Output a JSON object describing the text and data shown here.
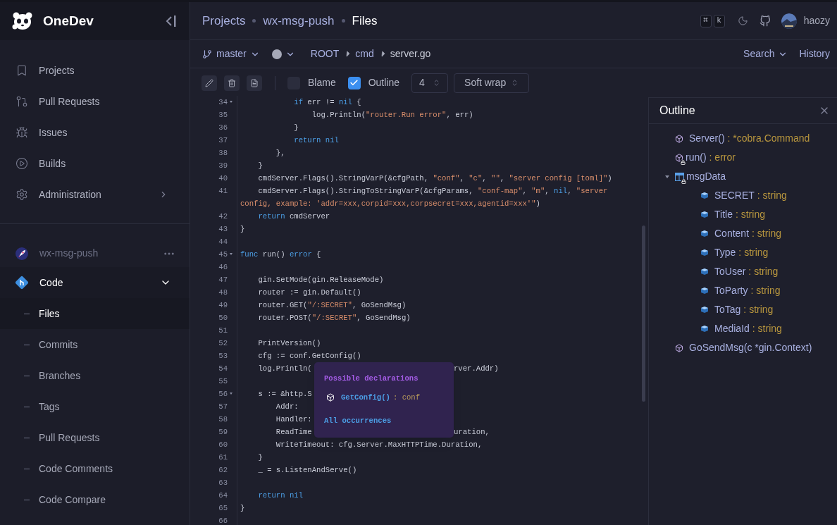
{
  "sidebar": {
    "brand": "OneDev",
    "nav": [
      {
        "kind": "projects",
        "label": "Projects",
        "has_children": false
      },
      {
        "kind": "pull-requests",
        "label": "Pull Requests",
        "has_children": false
      },
      {
        "kind": "issues",
        "label": "Issues",
        "has_children": false
      },
      {
        "kind": "builds",
        "label": "Builds",
        "has_children": false
      },
      {
        "kind": "administration",
        "label": "Administration",
        "has_children": true
      }
    ],
    "project": {
      "name": "wx-msg-push"
    },
    "project_nav": {
      "label": "Code",
      "expanded": true,
      "children": [
        {
          "label": "Files",
          "selected": true
        },
        {
          "label": "Commits",
          "selected": false
        },
        {
          "label": "Branches",
          "selected": false
        },
        {
          "label": "Tags",
          "selected": false
        },
        {
          "label": "Pull Requests",
          "selected": false
        },
        {
          "label": "Code Comments",
          "selected": false
        },
        {
          "label": "Code Compare",
          "selected": false
        }
      ]
    }
  },
  "header": {
    "breadcrumbs": [
      "Projects",
      "wx-msg-push",
      "Files"
    ],
    "shortcut": [
      "⌘",
      "k"
    ],
    "user": "haozy"
  },
  "file_bar": {
    "branch": "master",
    "path": [
      "ROOT",
      "cmd",
      "server.go"
    ],
    "actions": [
      {
        "label": "Search",
        "dropdown": true
      },
      {
        "label": "History",
        "dropdown": false
      }
    ]
  },
  "toolbar": {
    "options": [
      {
        "label": "Blame",
        "checked": false
      },
      {
        "label": "Outline",
        "checked": true
      }
    ],
    "tab_size": "4",
    "wrap_mode": "Soft wrap"
  },
  "code": [
    {
      "number": "34",
      "fold": true,
      "tokens": [
        {
          "kind": "kw",
          "text": "            if"
        },
        {
          "kind": "plain",
          "text": " err != "
        },
        {
          "kind": "kw",
          "text": "nil"
        },
        {
          "kind": "plain",
          "text": " {"
        }
      ]
    },
    {
      "number": "35",
      "fold": false,
      "tokens": [
        {
          "kind": "plain",
          "text": "                log.Println("
        },
        {
          "kind": "str",
          "text": "\"router.Run error\""
        },
        {
          "kind": "plain",
          "text": ", err)"
        }
      ]
    },
    {
      "number": "36",
      "fold": false,
      "tokens": [
        {
          "kind": "plain",
          "text": "            }"
        }
      ]
    },
    {
      "number": "37",
      "fold": false,
      "tokens": [
        {
          "kind": "kw",
          "text": "            return nil"
        }
      ]
    },
    {
      "number": "38",
      "fold": false,
      "tokens": [
        {
          "kind": "plain",
          "text": "        },"
        }
      ]
    },
    {
      "number": "39",
      "fold": false,
      "tokens": [
        {
          "kind": "plain",
          "text": "    }"
        }
      ]
    },
    {
      "number": "40",
      "fold": false,
      "tokens": [
        {
          "kind": "plain",
          "text": "    cmdServer.Flags().StringVarP(&cfgPath, "
        },
        {
          "kind": "str",
          "text": "\"conf\""
        },
        {
          "kind": "plain",
          "text": ", "
        },
        {
          "kind": "str",
          "text": "\"c\""
        },
        {
          "kind": "plain",
          "text": ", "
        },
        {
          "kind": "str",
          "text": "\"\""
        },
        {
          "kind": "plain",
          "text": ", "
        },
        {
          "kind": "str",
          "text": "\"server config [toml]\""
        },
        {
          "kind": "plain",
          "text": ")"
        }
      ]
    },
    {
      "number": "41",
      "fold": false,
      "tokens": [
        {
          "kind": "plain",
          "text": "    cmdServer.Flags().StringToStringVarP(&cfgParams, "
        },
        {
          "kind": "str",
          "text": "\"conf-map\""
        },
        {
          "kind": "plain",
          "text": ", "
        },
        {
          "kind": "str",
          "text": "\"m\""
        },
        {
          "kind": "plain",
          "text": ", "
        },
        {
          "kind": "kw",
          "text": "nil"
        },
        {
          "kind": "plain",
          "text": ", "
        },
        {
          "kind": "str",
          "text": "\"server config, example: 'addr=xxx,corpid=xxx,corpsecret=xxx,agentid=xxx'\""
        },
        {
          "kind": "plain",
          "text": ")"
        }
      ]
    },
    {
      "number": "42",
      "fold": false,
      "tokens": [
        {
          "kind": "kw",
          "text": "    return"
        },
        {
          "kind": "plain",
          "text": " cmdServer"
        }
      ]
    },
    {
      "number": "43",
      "fold": false,
      "tokens": [
        {
          "kind": "plain",
          "text": "}"
        }
      ]
    },
    {
      "number": "44",
      "fold": false
    },
    {
      "number": "45",
      "fold": true,
      "tokens": [
        {
          "kind": "kw",
          "text": "func"
        },
        {
          "kind": "plain",
          "text": " run() "
        },
        {
          "kind": "kw",
          "text": "error"
        },
        {
          "kind": "plain",
          "text": " {"
        }
      ]
    },
    {
      "number": "46",
      "fold": false
    },
    {
      "number": "47",
      "fold": false,
      "tokens": [
        {
          "kind": "plain",
          "text": "    gin.SetMode(gin.ReleaseMode)"
        }
      ]
    },
    {
      "number": "48",
      "fold": false,
      "tokens": [
        {
          "kind": "plain",
          "text": "    router := gin.Default()"
        }
      ]
    },
    {
      "number": "49",
      "fold": false,
      "tokens": [
        {
          "kind": "plain",
          "text": "    router.GET("
        },
        {
          "kind": "str",
          "text": "\"/:SECRET\""
        },
        {
          "kind": "plain",
          "text": ", GoSendMsg)"
        }
      ]
    },
    {
      "number": "50",
      "fold": false,
      "tokens": [
        {
          "kind": "plain",
          "text": "    router.POST("
        },
        {
          "kind": "str",
          "text": "\"/:SECRET\""
        },
        {
          "kind": "plain",
          "text": ", GoSendMsg)"
        }
      ]
    },
    {
      "number": "51",
      "fold": false
    },
    {
      "number": "52",
      "fold": false,
      "tokens": [
        {
          "kind": "plain",
          "text": "    PrintVersion()"
        }
      ]
    },
    {
      "number": "53",
      "fold": false,
      "tokens": [
        {
          "kind": "plain",
          "text": "    cfg := conf.GetConfig()"
        }
      ]
    },
    {
      "number": "54",
      "fold": false,
      "tokens": [
        {
          "kind": "plain",
          "text": "    log.Println("
        }
      ],
      "tail": "rver.Addr)"
    },
    {
      "number": "55",
      "fold": false
    },
    {
      "number": "56",
      "fold": true,
      "tokens": [
        {
          "kind": "plain",
          "text": "    s := &http.S"
        }
      ]
    },
    {
      "number": "57",
      "fold": false,
      "tokens": [
        {
          "kind": "plain",
          "text": "        Addr:"
        }
      ]
    },
    {
      "number": "58",
      "fold": false,
      "tokens": [
        {
          "kind": "plain",
          "text": "        Handler:"
        }
      ]
    },
    {
      "number": "59",
      "fold": false,
      "tokens": [
        {
          "kind": "plain",
          "text": "        ReadTime"
        }
      ],
      "tail": "uration,"
    },
    {
      "number": "60",
      "fold": false,
      "tokens": [
        {
          "kind": "plain",
          "text": "        WriteTimeout: cfg.Server.MaxHTTPTime.Duration,"
        }
      ]
    },
    {
      "number": "61",
      "fold": false,
      "tokens": [
        {
          "kind": "plain",
          "text": "    }"
        }
      ]
    },
    {
      "number": "62",
      "fold": false,
      "tokens": [
        {
          "kind": "plain",
          "text": "    _ = s.ListenAndServe()"
        }
      ]
    },
    {
      "number": "63",
      "fold": false
    },
    {
      "number": "64",
      "fold": false,
      "tokens": [
        {
          "kind": "kw",
          "text": "    return nil"
        }
      ]
    },
    {
      "number": "65",
      "fold": false,
      "tokens": [
        {
          "kind": "plain",
          "text": "}"
        }
      ]
    },
    {
      "number": "66",
      "fold": false
    }
  ],
  "popup": {
    "title": "Possible declarations",
    "items": [
      {
        "name": "GetConfig()",
        "type": ": conf"
      }
    ],
    "link": "All occurrences"
  },
  "outline": {
    "title": "Outline",
    "items": [
      {
        "kind": "method",
        "name": "Server()",
        "type": ": *cobra.Command",
        "private": false
      },
      {
        "kind": "method",
        "name": "run()",
        "type": ": error",
        "private": true
      },
      {
        "kind": "struct",
        "name": "msgData",
        "private": true,
        "expanded": true,
        "children": [
          {
            "kind": "field",
            "name": "SECRET",
            "type": ": string",
            "private": false
          },
          {
            "kind": "field",
            "name": "Title",
            "type": ": string",
            "private": false
          },
          {
            "kind": "field",
            "name": "Content",
            "type": ": string",
            "private": false
          },
          {
            "kind": "field",
            "name": "Type",
            "type": ": string",
            "private": false
          },
          {
            "kind": "field",
            "name": "ToUser",
            "type": ": string",
            "private": false
          },
          {
            "kind": "field",
            "name": "ToParty",
            "type": ": string",
            "private": false
          },
          {
            "kind": "field",
            "name": "ToTag",
            "type": ": string",
            "private": false
          },
          {
            "kind": "field",
            "name": "MediaId",
            "type": ": string",
            "private": false
          }
        ]
      },
      {
        "kind": "method",
        "name": "GoSendMsg(c *gin.Context)",
        "private": false
      }
    ]
  }
}
